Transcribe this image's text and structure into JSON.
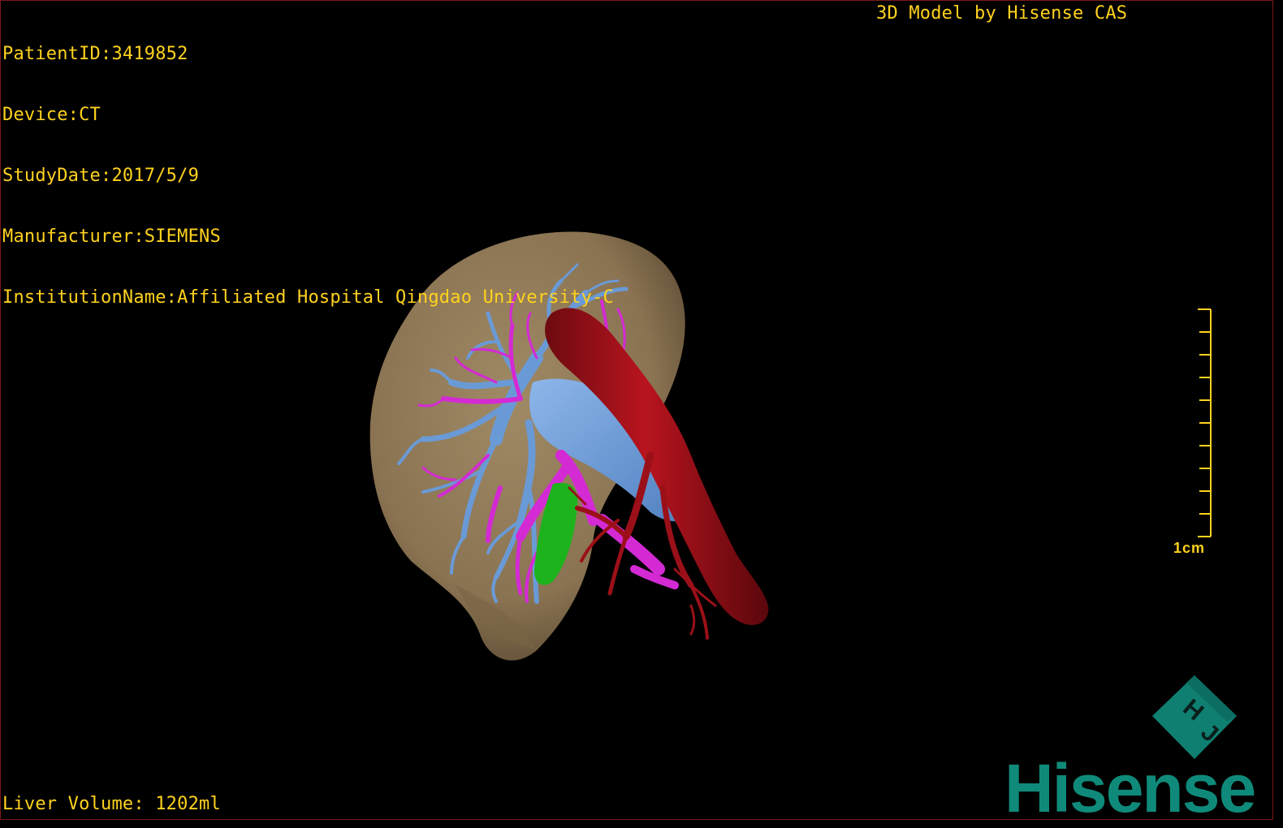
{
  "header": {
    "patient_id": "PatientID:3419852",
    "device": "Device:CT",
    "study_date": "StudyDate:2017/5/9",
    "manufacturer": "Manufacturer:SIEMENS",
    "institution": "InstitutionName:Affiliated Hospital Qingdao University-C"
  },
  "model_credit": "3D Model by Hisense CAS",
  "scale_bar": {
    "label": "1cm",
    "ticks": 10
  },
  "footer": {
    "liver_volume": "Liver Volume: 1202ml"
  },
  "brand": {
    "name": "Hisense",
    "cube_letters": "H J",
    "color": "#0f8a7a"
  },
  "colors": {
    "overlay_text": "#ffd21e",
    "liver": "#8c7654",
    "portal_vein": "#6a9ad6",
    "hepatic_vessels": "#d42ad4",
    "artery": "#a3111a",
    "gallbladder": "#1db31d"
  }
}
